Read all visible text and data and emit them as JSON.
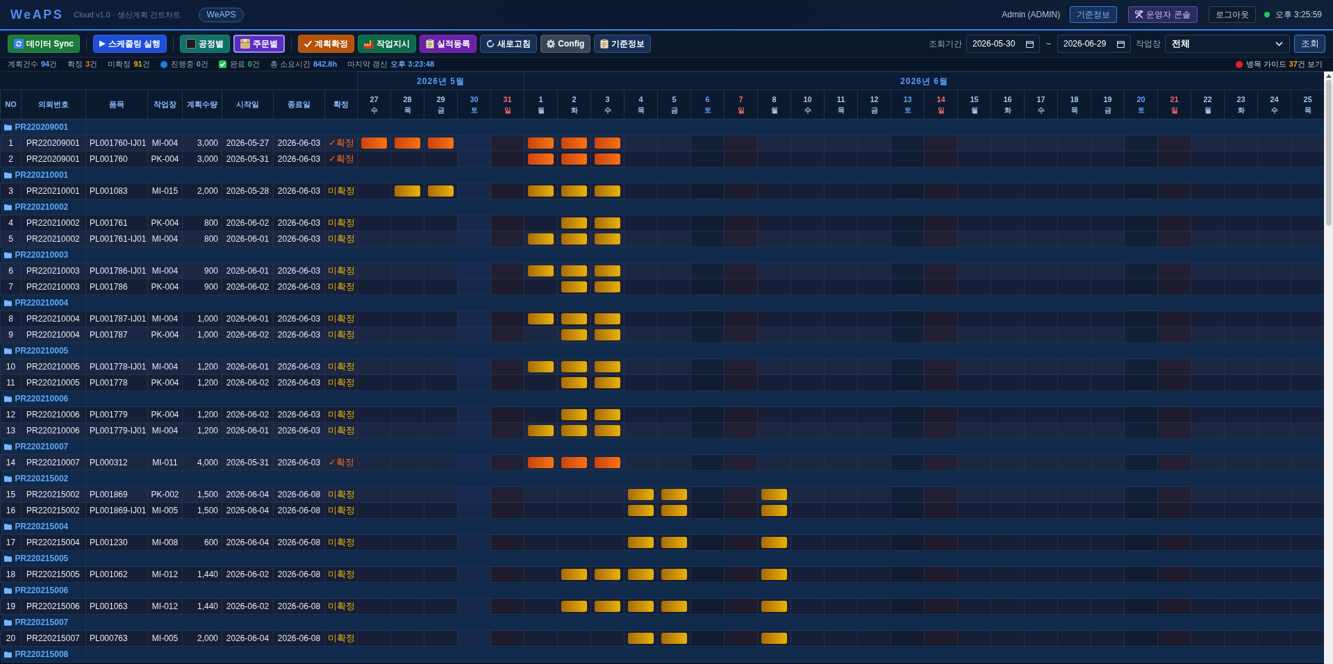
{
  "header": {
    "logo": "WeAPS",
    "subtitle": "Cloud v1.0 · 생산계획 간트차트",
    "badge": "WeAPS",
    "user": "Admin (ADMIN)",
    "buttons": [
      {
        "kind": "info",
        "label": "기준정보"
      },
      {
        "kind": "console",
        "label": "운영자 콘솔"
      },
      {
        "kind": "logout",
        "label": "로그아웃"
      }
    ],
    "connected": true,
    "clock": "오후 3:25:59"
  },
  "toolbar": {
    "button_groups": [
      [
        {
          "kind": "sync",
          "label": "데이터 Sync"
        }
      ],
      [
        {
          "kind": "run",
          "label": "스케줄링 실행"
        }
      ],
      [
        {
          "kind": "process_view",
          "label": "공정별",
          "selected": false
        },
        {
          "kind": "order_view",
          "label": "주문별",
          "selected": true
        }
      ],
      [
        {
          "kind": "confirm",
          "label": "계획확정"
        },
        {
          "kind": "work_order",
          "label": "작업지시"
        },
        {
          "kind": "results",
          "label": "실적등록"
        },
        {
          "kind": "refresh",
          "label": "새로고침"
        },
        {
          "kind": "config",
          "label": "Config"
        },
        {
          "kind": "info",
          "label": "기준정보"
        }
      ]
    ],
    "filter": {
      "period_label": "조회기간",
      "from": "2026-05-30",
      "range_separator": "~",
      "to": "2026-06-29",
      "site_label": "작업장",
      "site": "전체",
      "search_button": "조회"
    }
  },
  "summary": {
    "stats": [
      {
        "kind": "total",
        "label": "계획건수",
        "value": "94",
        "unit": "건"
      },
      {
        "kind": "confirmed",
        "label": "확정",
        "value": "3",
        "unit": "건"
      },
      {
        "kind": "unconfirmed",
        "label": "미확정",
        "value": "91",
        "unit": "건"
      },
      {
        "kind": "in_progress",
        "label": "진행중",
        "value": "0",
        "unit": "건"
      },
      {
        "kind": "done",
        "label": "완료",
        "value": "0",
        "unit": "건"
      },
      {
        "kind": "hours",
        "label": "총 소요시간",
        "value": "842.8h"
      },
      {
        "kind": "updated",
        "label": "마지막 갱신",
        "value": "오후 3:23:48"
      }
    ],
    "bottleneck": {
      "label": "병목 가이드",
      "count": "37",
      "suffix": "건 보기"
    }
  },
  "table": {
    "columns": [
      "NO",
      "의뢰번호",
      "품목",
      "작업장",
      "계획수량",
      "시작일",
      "종료일",
      "확정"
    ],
    "months": [
      {
        "label": "2026년 5월",
        "days": [
          {
            "day": "27",
            "weekday": "수",
            "kind": "weekday",
            "highlighted": false
          },
          {
            "day": "28",
            "weekday": "목",
            "kind": "weekday",
            "highlighted": false
          },
          {
            "day": "29",
            "weekday": "금",
            "kind": "weekday",
            "highlighted": false
          },
          {
            "day": "30",
            "weekday": "토",
            "kind": "saturday",
            "highlighted": true
          },
          {
            "day": "31",
            "weekday": "일",
            "kind": "sunday",
            "highlighted": false
          }
        ]
      },
      {
        "label": "2026년 6월",
        "days": [
          {
            "day": "1",
            "weekday": "월",
            "kind": "weekday",
            "highlighted": false
          },
          {
            "day": "2",
            "weekday": "화",
            "kind": "weekday",
            "highlighted": false
          },
          {
            "day": "3",
            "weekday": "수",
            "kind": "weekday",
            "highlighted": false
          },
          {
            "day": "4",
            "weekday": "목",
            "kind": "weekday",
            "highlighted": false
          },
          {
            "day": "5",
            "weekday": "금",
            "kind": "weekday",
            "highlighted": false
          },
          {
            "day": "6",
            "weekday": "토",
            "kind": "saturday",
            "highlighted": false
          },
          {
            "day": "7",
            "weekday": "일",
            "kind": "sunday",
            "highlighted": false
          },
          {
            "day": "8",
            "weekday": "월",
            "kind": "weekday",
            "highlighted": false
          },
          {
            "day": "10",
            "weekday": "수",
            "kind": "weekday",
            "highlighted": false
          },
          {
            "day": "11",
            "weekday": "목",
            "kind": "weekday",
            "highlighted": false
          },
          {
            "day": "12",
            "weekday": "금",
            "kind": "weekday",
            "highlighted": false
          },
          {
            "day": "13",
            "weekday": "토",
            "kind": "saturday",
            "highlighted": false
          },
          {
            "day": "14",
            "weekday": "일",
            "kind": "sunday",
            "highlighted": false
          },
          {
            "day": "15",
            "weekday": "월",
            "kind": "weekday",
            "highlighted": false
          },
          {
            "day": "16",
            "weekday": "화",
            "kind": "weekday",
            "highlighted": false
          },
          {
            "day": "17",
            "weekday": "수",
            "kind": "weekday",
            "highlighted": false
          },
          {
            "day": "18",
            "weekday": "목",
            "kind": "weekday",
            "highlighted": false
          },
          {
            "day": "19",
            "weekday": "금",
            "kind": "weekday",
            "highlighted": false
          },
          {
            "day": "20",
            "weekday": "토",
            "kind": "saturday",
            "highlighted": false
          },
          {
            "day": "21",
            "weekday": "일",
            "kind": "sunday",
            "highlighted": false
          },
          {
            "day": "22",
            "weekday": "월",
            "kind": "weekday",
            "highlighted": false
          },
          {
            "day": "23",
            "weekday": "화",
            "kind": "weekday",
            "highlighted": false
          },
          {
            "day": "24",
            "weekday": "수",
            "kind": "weekday",
            "highlighted": false
          },
          {
            "day": "25",
            "weekday": "목",
            "kind": "weekday",
            "highlighted": false
          }
        ]
      }
    ],
    "groups": [
      {
        "order": "PR220209001",
        "rows": [
          {
            "no": "1",
            "request_no": "PR220209001",
            "item": "PL001760-IJ01",
            "site": "MI-004",
            "quantity": "3,000",
            "start": "2026-05-27",
            "end": "2026-06-03",
            "status": "✓확정",
            "confirmed": true,
            "scheduled": [
              true,
              true,
              true,
              false,
              false,
              true,
              true,
              true,
              false,
              false,
              false,
              false,
              false,
              false,
              false,
              false,
              false,
              false,
              false,
              false,
              false,
              false,
              false,
              false,
              false,
              false,
              false,
              false,
              false
            ]
          },
          {
            "no": "2",
            "request_no": "PR220209001",
            "item": "PL001760",
            "site": "PK-004",
            "quantity": "3,000",
            "start": "2026-05-31",
            "end": "2026-06-03",
            "status": "✓확정",
            "confirmed": true,
            "scheduled": [
              false,
              false,
              false,
              false,
              false,
              true,
              true,
              true,
              false,
              false,
              false,
              false,
              false,
              false,
              false,
              false,
              false,
              false,
              false,
              false,
              false,
              false,
              false,
              false,
              false,
              false,
              false,
              false,
              false
            ]
          }
        ]
      },
      {
        "order": "PR220210001",
        "rows": [
          {
            "no": "3",
            "request_no": "PR220210001",
            "item": "PL001083",
            "site": "MI-015",
            "quantity": "2,000",
            "start": "2026-05-28",
            "end": "2026-06-03",
            "status": "미확정",
            "confirmed": false,
            "scheduled": [
              false,
              true,
              true,
              false,
              false,
              true,
              true,
              true,
              false,
              false,
              false,
              false,
              false,
              false,
              false,
              false,
              false,
              false,
              false,
              false,
              false,
              false,
              false,
              false,
              false,
              false,
              false,
              false,
              false
            ]
          }
        ]
      },
      {
        "order": "PR220210002",
        "rows": [
          {
            "no": "4",
            "request_no": "PR220210002",
            "item": "PL001761",
            "site": "PK-004",
            "quantity": "800",
            "start": "2026-06-02",
            "end": "2026-06-03",
            "status": "미확정",
            "confirmed": false,
            "scheduled": [
              false,
              false,
              false,
              false,
              false,
              false,
              true,
              true,
              false,
              false,
              false,
              false,
              false,
              false,
              false,
              false,
              false,
              false,
              false,
              false,
              false,
              false,
              false,
              false,
              false,
              false,
              false,
              false,
              false
            ]
          },
          {
            "no": "5",
            "request_no": "PR220210002",
            "item": "PL001761-IJ01",
            "site": "MI-004",
            "quantity": "800",
            "start": "2026-06-01",
            "end": "2026-06-03",
            "status": "미확정",
            "confirmed": false,
            "scheduled": [
              false,
              false,
              false,
              false,
              false,
              true,
              true,
              true,
              false,
              false,
              false,
              false,
              false,
              false,
              false,
              false,
              false,
              false,
              false,
              false,
              false,
              false,
              false,
              false,
              false,
              false,
              false,
              false,
              false
            ]
          }
        ]
      },
      {
        "order": "PR220210003",
        "rows": [
          {
            "no": "6",
            "request_no": "PR220210003",
            "item": "PL001786-IJ01",
            "site": "MI-004",
            "quantity": "900",
            "start": "2026-06-01",
            "end": "2026-06-03",
            "status": "미확정",
            "confirmed": false,
            "scheduled": [
              false,
              false,
              false,
              false,
              false,
              true,
              true,
              true,
              false,
              false,
              false,
              false,
              false,
              false,
              false,
              false,
              false,
              false,
              false,
              false,
              false,
              false,
              false,
              false,
              false,
              false,
              false,
              false,
              false
            ]
          },
          {
            "no": "7",
            "request_no": "PR220210003",
            "item": "PL001786",
            "site": "PK-004",
            "quantity": "900",
            "start": "2026-06-02",
            "end": "2026-06-03",
            "status": "미확정",
            "confirmed": false,
            "scheduled": [
              false,
              false,
              false,
              false,
              false,
              false,
              true,
              true,
              false,
              false,
              false,
              false,
              false,
              false,
              false,
              false,
              false,
              false,
              false,
              false,
              false,
              false,
              false,
              false,
              false,
              false,
              false,
              false,
              false
            ]
          }
        ]
      },
      {
        "order": "PR220210004",
        "rows": [
          {
            "no": "8",
            "request_no": "PR220210004",
            "item": "PL001787-IJ01",
            "site": "MI-004",
            "quantity": "1,000",
            "start": "2026-06-01",
            "end": "2026-06-03",
            "status": "미확정",
            "confirmed": false,
            "scheduled": [
              false,
              false,
              false,
              false,
              false,
              true,
              true,
              true,
              false,
              false,
              false,
              false,
              false,
              false,
              false,
              false,
              false,
              false,
              false,
              false,
              false,
              false,
              false,
              false,
              false,
              false,
              false,
              false,
              false
            ]
          },
          {
            "no": "9",
            "request_no": "PR220210004",
            "item": "PL001787",
            "site": "PK-004",
            "quantity": "1,000",
            "start": "2026-06-02",
            "end": "2026-06-03",
            "status": "미확정",
            "confirmed": false,
            "scheduled": [
              false,
              false,
              false,
              false,
              false,
              false,
              true,
              true,
              false,
              false,
              false,
              false,
              false,
              false,
              false,
              false,
              false,
              false,
              false,
              false,
              false,
              false,
              false,
              false,
              false,
              false,
              false,
              false,
              false
            ]
          }
        ]
      },
      {
        "order": "PR220210005",
        "rows": [
          {
            "no": "10",
            "request_no": "PR220210005",
            "item": "PL001778-IJ01",
            "site": "MI-004",
            "quantity": "1,200",
            "start": "2026-06-01",
            "end": "2026-06-03",
            "status": "미확정",
            "confirmed": false,
            "scheduled": [
              false,
              false,
              false,
              false,
              false,
              true,
              true,
              true,
              false,
              false,
              false,
              false,
              false,
              false,
              false,
              false,
              false,
              false,
              false,
              false,
              false,
              false,
              false,
              false,
              false,
              false,
              false,
              false,
              false
            ]
          },
          {
            "no": "11",
            "request_no": "PR220210005",
            "item": "PL001778",
            "site": "PK-004",
            "quantity": "1,200",
            "start": "2026-06-02",
            "end": "2026-06-03",
            "status": "미확정",
            "confirmed": false,
            "scheduled": [
              false,
              false,
              false,
              false,
              false,
              false,
              true,
              true,
              false,
              false,
              false,
              false,
              false,
              false,
              false,
              false,
              false,
              false,
              false,
              false,
              false,
              false,
              false,
              false,
              false,
              false,
              false,
              false,
              false
            ]
          }
        ]
      },
      {
        "order": "PR220210006",
        "rows": [
          {
            "no": "12",
            "request_no": "PR220210006",
            "item": "PL001779",
            "site": "PK-004",
            "quantity": "1,200",
            "start": "2026-06-02",
            "end": "2026-06-03",
            "status": "미확정",
            "confirmed": false,
            "scheduled": [
              false,
              false,
              false,
              false,
              false,
              false,
              true,
              true,
              false,
              false,
              false,
              false,
              false,
              false,
              false,
              false,
              false,
              false,
              false,
              false,
              false,
              false,
              false,
              false,
              false,
              false,
              false,
              false,
              false
            ]
          },
          {
            "no": "13",
            "request_no": "PR220210006",
            "item": "PL001779-IJ01",
            "site": "MI-004",
            "quantity": "1,200",
            "start": "2026-06-01",
            "end": "2026-06-03",
            "status": "미확정",
            "confirmed": false,
            "scheduled": [
              false,
              false,
              false,
              false,
              false,
              true,
              true,
              true,
              false,
              false,
              false,
              false,
              false,
              false,
              false,
              false,
              false,
              false,
              false,
              false,
              false,
              false,
              false,
              false,
              false,
              false,
              false,
              false,
              false
            ]
          }
        ]
      },
      {
        "order": "PR220210007",
        "rows": [
          {
            "no": "14",
            "request_no": "PR220210007",
            "item": "PL000312",
            "site": "MI-011",
            "quantity": "4,000",
            "start": "2026-05-31",
            "end": "2026-06-03",
            "status": "✓확정",
            "confirmed": true,
            "scheduled": [
              false,
              false,
              false,
              false,
              false,
              true,
              true,
              true,
              false,
              false,
              false,
              false,
              false,
              false,
              false,
              false,
              false,
              false,
              false,
              false,
              false,
              false,
              false,
              false,
              false,
              false,
              false,
              false,
              false
            ]
          }
        ]
      },
      {
        "order": "PR220215002",
        "rows": [
          {
            "no": "15",
            "request_no": "PR220215002",
            "item": "PL001869",
            "site": "PK-002",
            "quantity": "1,500",
            "start": "2026-06-04",
            "end": "2026-06-08",
            "status": "미확정",
            "confirmed": false,
            "scheduled": [
              false,
              false,
              false,
              false,
              false,
              false,
              false,
              false,
              true,
              true,
              false,
              false,
              true,
              false,
              false,
              false,
              false,
              false,
              false,
              false,
              false,
              false,
              false,
              false,
              false,
              false,
              false,
              false,
              false
            ]
          },
          {
            "no": "16",
            "request_no": "PR220215002",
            "item": "PL001869-IJ01",
            "site": "MI-005",
            "quantity": "1,500",
            "start": "2026-06-04",
            "end": "2026-06-08",
            "status": "미확정",
            "confirmed": false,
            "scheduled": [
              false,
              false,
              false,
              false,
              false,
              false,
              false,
              false,
              true,
              true,
              false,
              false,
              true,
              false,
              false,
              false,
              false,
              false,
              false,
              false,
              false,
              false,
              false,
              false,
              false,
              false,
              false,
              false,
              false
            ]
          }
        ]
      },
      {
        "order": "PR220215004",
        "rows": [
          {
            "no": "17",
            "request_no": "PR220215004",
            "item": "PL001230",
            "site": "MI-008",
            "quantity": "600",
            "start": "2026-06-04",
            "end": "2026-06-08",
            "status": "미확정",
            "confirmed": false,
            "scheduled": [
              false,
              false,
              false,
              false,
              false,
              false,
              false,
              false,
              true,
              true,
              false,
              false,
              true,
              false,
              false,
              false,
              false,
              false,
              false,
              false,
              false,
              false,
              false,
              false,
              false,
              false,
              false,
              false,
              false
            ]
          }
        ]
      },
      {
        "order": "PR220215005",
        "rows": [
          {
            "no": "18",
            "request_no": "PR220215005",
            "item": "PL001062",
            "site": "MI-012",
            "quantity": "1,440",
            "start": "2026-06-02",
            "end": "2026-06-08",
            "status": "미확정",
            "confirmed": false,
            "scheduled": [
              false,
              false,
              false,
              false,
              false,
              false,
              true,
              true,
              true,
              true,
              false,
              false,
              true,
              false,
              false,
              false,
              false,
              false,
              false,
              false,
              false,
              false,
              false,
              false,
              false,
              false,
              false,
              false,
              false
            ]
          }
        ]
      },
      {
        "order": "PR220215006",
        "rows": [
          {
            "no": "19",
            "request_no": "PR220215006",
            "item": "PL001063",
            "site": "MI-012",
            "quantity": "1,440",
            "start": "2026-06-02",
            "end": "2026-06-08",
            "status": "미확정",
            "confirmed": false,
            "scheduled": [
              false,
              false,
              false,
              false,
              false,
              false,
              true,
              true,
              true,
              true,
              false,
              false,
              true,
              false,
              false,
              false,
              false,
              false,
              false,
              false,
              false,
              false,
              false,
              false,
              false,
              false,
              false,
              false,
              false
            ]
          }
        ]
      },
      {
        "order": "PR220215007",
        "rows": [
          {
            "no": "20",
            "request_no": "PR220215007",
            "item": "PL000763",
            "site": "MI-005",
            "quantity": "2,000",
            "start": "2026-06-04",
            "end": "2026-06-08",
            "status": "미확정",
            "confirmed": false,
            "scheduled": [
              false,
              false,
              false,
              false,
              false,
              false,
              false,
              false,
              true,
              true,
              false,
              false,
              true,
              false,
              false,
              false,
              false,
              false,
              false,
              false,
              false,
              false,
              false,
              false,
              false,
              false,
              false,
              false,
              false
            ]
          }
        ]
      },
      {
        "order": "PR220215008"
      }
    ]
  }
}
